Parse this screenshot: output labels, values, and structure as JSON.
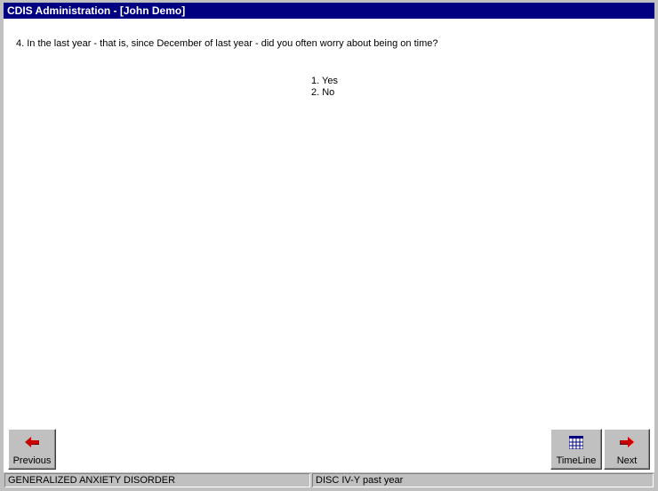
{
  "window": {
    "title": "CDIS Administration - [John Demo]"
  },
  "question": {
    "text": "4. In the last year - that is, since December of last year - did you often worry about being on time?",
    "options": [
      "1. Yes",
      "2. No"
    ]
  },
  "buttons": {
    "previous_label": "Previous",
    "timeline_label": "TimeLine",
    "next_label": "Next"
  },
  "icons": {
    "previous": "left-arrow-icon",
    "timeline": "calendar-icon",
    "next": "right-arrow-icon"
  },
  "status": {
    "module": "GENERALIZED ANXIETY DISORDER",
    "instrument": "DISC IV-Y past year"
  },
  "colors": {
    "title_bar": "#000080",
    "chrome": "#c0c0c0",
    "arrow_red": "#cc0000"
  }
}
